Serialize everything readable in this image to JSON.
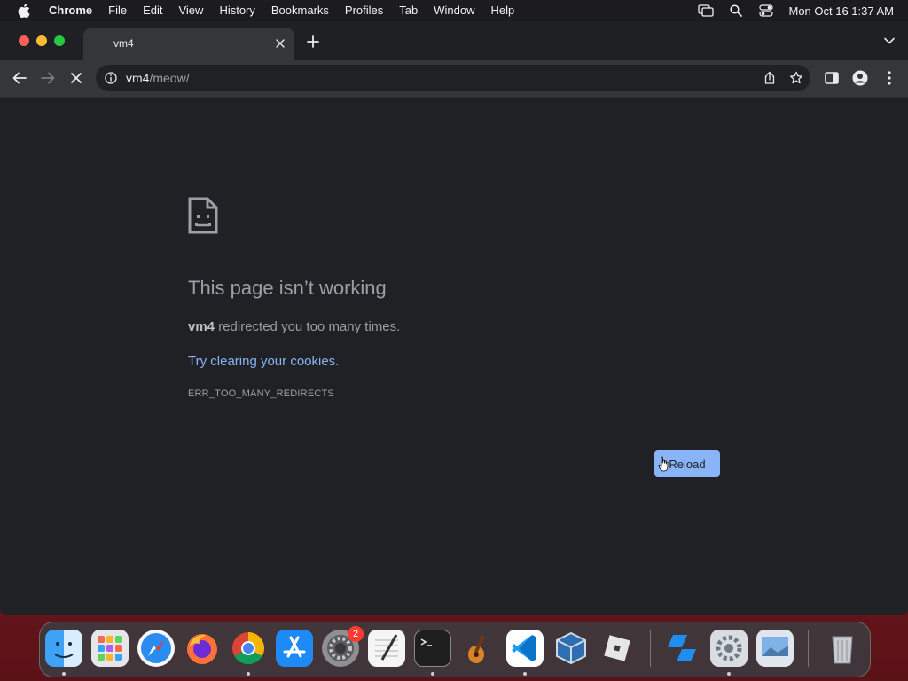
{
  "menubar": {
    "apple_icon": "apple-icon",
    "items": [
      "Chrome",
      "File",
      "Edit",
      "View",
      "History",
      "Bookmarks",
      "Profiles",
      "Tab",
      "Window",
      "Help"
    ],
    "clock": "Mon Oct 16  1:37 AM"
  },
  "tab": {
    "title": "vm4"
  },
  "omnibox": {
    "host": "vm4",
    "path": "/meow/"
  },
  "error": {
    "title": "This page isn’t working",
    "host": "vm4",
    "description": " redirected you too many times.",
    "link": "Try clearing your cookies.",
    "code": "ERR_TOO_MANY_REDIRECTS",
    "reload_label": "Reload"
  },
  "dock": {
    "badge_count": "2",
    "apps": [
      "Finder",
      "Launchpad",
      "Safari",
      "Firefox",
      "Chrome",
      "App Store",
      "System Preferences",
      "TextEdit",
      "Terminal",
      "GarageBand",
      "Visual Studio Code",
      "VirtualBox",
      "Roblox",
      "Roblox Studio",
      "Utility",
      "Preview",
      "Trash"
    ]
  },
  "colors": {
    "accent": "#8ab4f8",
    "page_bg": "#202124",
    "toolbar_bg": "#35363a"
  }
}
